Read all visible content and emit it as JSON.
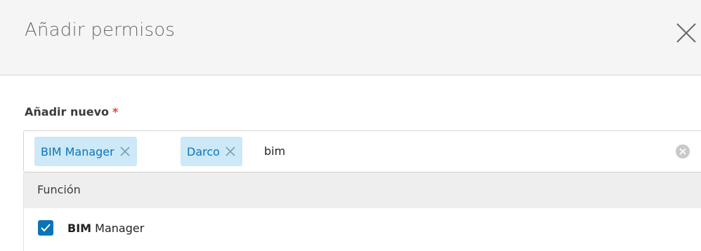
{
  "dialog": {
    "title": "Añadir permisos",
    "close_icon": "close-icon"
  },
  "field": {
    "label": "Añadir nuevo",
    "required_mark": "*"
  },
  "selected_chips": [
    {
      "label": "BIM Manager",
      "remove_icon": "close-icon"
    },
    {
      "label": "Darco",
      "remove_icon": "close-icon"
    }
  ],
  "search": {
    "value": "bim",
    "clear_icon": "clear-circle-icon"
  },
  "dropdown": {
    "group_label": "Función",
    "options": [
      {
        "match": "BIM",
        "rest": " Manager",
        "checked": true
      }
    ]
  },
  "colors": {
    "accent": "#0a74b8",
    "chip_bg": "#cde8f6",
    "required": "#e8452c"
  }
}
